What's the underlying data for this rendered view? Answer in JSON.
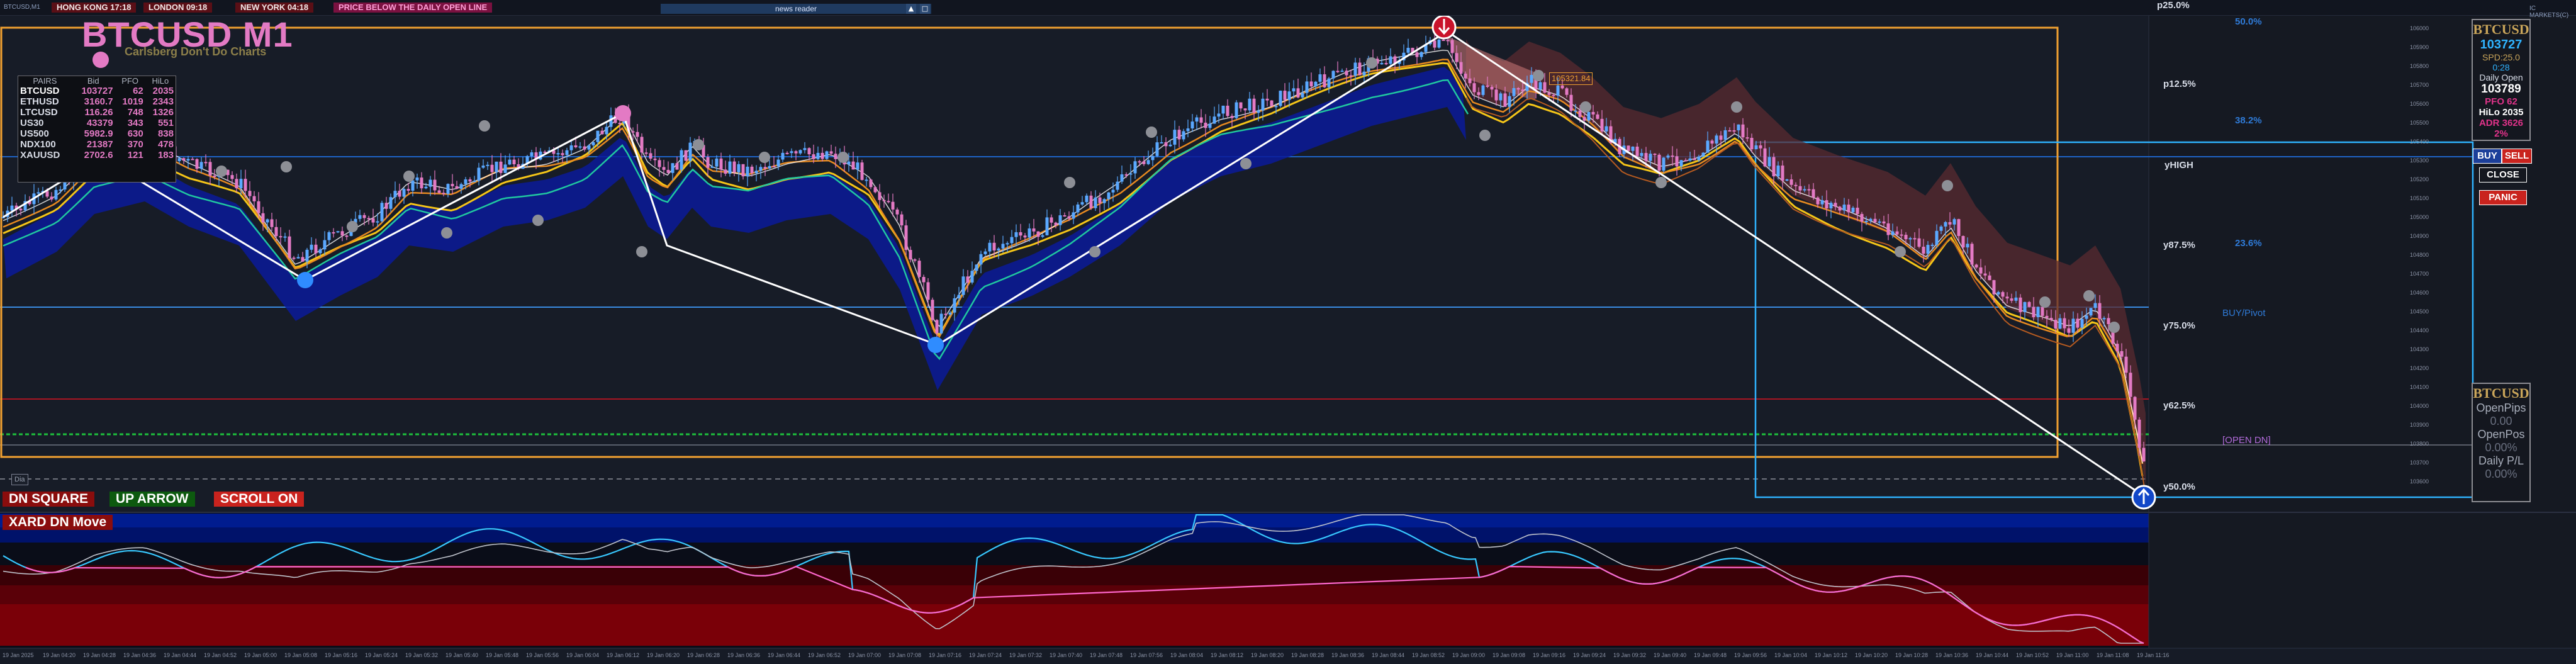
{
  "top_bar": {
    "window_label": "BTCUSD,M1",
    "hongkong": "HONG KONG 17:18",
    "london": "LONDON  09:18",
    "newyork": "NEW YORK  04:18",
    "warning": "PRICE BELOW THE DAILY OPEN LINE",
    "news": "news reader",
    "arrow_btn": "▲",
    "close_btn": "□",
    "right_label": "IC MARKETS(C)"
  },
  "chart_title": "BTCUSD M1",
  "chart_subtitle": "Carlsberg Don't Do Charts",
  "pairs_table": {
    "headers": [
      "PAIRS",
      "Bid",
      "PFO",
      "HiLo"
    ],
    "rows": [
      {
        "name": "BTCUSD",
        "bid": "103727",
        "pfo": "62",
        "hilo": "2035"
      },
      {
        "name": "ETHUSD",
        "bid": "3160.7",
        "pfo": "1019",
        "hilo": "2343"
      },
      {
        "name": "LTCUSD",
        "bid": "116.26",
        "pfo": "748",
        "hilo": "1326"
      },
      {
        "name": "US30",
        "bid": "43379",
        "pfo": "343",
        "hilo": "551"
      },
      {
        "name": "US500",
        "bid": "5982.9",
        "pfo": "630",
        "hilo": "838"
      },
      {
        "name": "NDX100",
        "bid": "21387",
        "pfo": "370",
        "hilo": "478"
      },
      {
        "name": "XAUUSD",
        "bid": "2702.6",
        "pfo": "121",
        "hilo": "183"
      }
    ]
  },
  "status_buttons": {
    "dn_square": "DN SQUARE",
    "up_arrow": "UP ARROW",
    "scroll": "SCROLL ON"
  },
  "indicator_label": "XARD DN Move",
  "small_label": "Dia",
  "box_price": "105321.84",
  "levels": {
    "p25": "p25.0%",
    "p12": "p12.5%",
    "yhigh": "yHIGH",
    "y87": "y87.5%",
    "y75": "y75.0%",
    "y62": "y62.5%",
    "y50": "y50.0%",
    "r50": "50.0%",
    "r38": "38.2%",
    "r23": "23.6%",
    "buy_pivot": "BUY/Pivot",
    "open_dn": "[OPEN DN]"
  },
  "right_panel": {
    "symbol": "BTCUSD",
    "price": "103727",
    "spread": "SPD:25.0",
    "timer": "0:28",
    "daily_open_label": "Daily Open",
    "daily_open": "103789",
    "pfo": "PFO   62",
    "hilo": "HiLo 2035",
    "adr": "ADR 3626",
    "adr_pct": "2%",
    "buy": "BUY",
    "sell": "SELL",
    "close": "CLOSE",
    "panic": "PANIC"
  },
  "position_panel": {
    "symbol": "BTCUSD",
    "open_pips_label": "OpenPips",
    "open_pips": "0.00",
    "open_pos_label": "OpenPos",
    "open_pos": "0.00%",
    "daily_pl_label": "Daily P/L",
    "daily_pl": "0.00%"
  },
  "price_axis": [
    "106000",
    "105900",
    "105800",
    "105700",
    "105600",
    "105500",
    "105400",
    "105300",
    "105200",
    "105100",
    "105000",
    "104900",
    "104800",
    "104700",
    "104600",
    "104500",
    "104400",
    "104300",
    "104200",
    "104100",
    "104000",
    "103900",
    "103800",
    "103700",
    "103600"
  ],
  "time_axis": [
    "19 Jan 2025",
    "19 Jan 04:20",
    "19 Jan 04:28",
    "19 Jan 04:36",
    "19 Jan 04:44",
    "19 Jan 04:52",
    "19 Jan 05:00",
    "19 Jan 05:08",
    "19 Jan 05:16",
    "19 Jan 05:24",
    "19 Jan 05:32",
    "19 Jan 05:40",
    "19 Jan 05:48",
    "19 Jan 05:56",
    "19 Jan 06:04",
    "19 Jan 06:12",
    "19 Jan 06:20",
    "19 Jan 06:28",
    "19 Jan 06:36",
    "19 Jan 06:44",
    "19 Jan 06:52",
    "19 Jan 07:00",
    "19 Jan 07:08",
    "19 Jan 07:16",
    "19 Jan 07:24",
    "19 Jan 07:32",
    "19 Jan 07:40",
    "19 Jan 07:48",
    "19 Jan 07:56",
    "19 Jan 08:04",
    "19 Jan 08:12",
    "19 Jan 08:20",
    "19 Jan 08:28",
    "19 Jan 08:36",
    "19 Jan 08:44",
    "19 Jan 08:52",
    "19 Jan 09:00",
    "19 Jan 09:08",
    "19 Jan 09:16",
    "19 Jan 09:24",
    "19 Jan 09:32",
    "19 Jan 09:40",
    "19 Jan 09:48",
    "19 Jan 09:56",
    "19 Jan 10:04",
    "19 Jan 10:12",
    "19 Jan 10:20",
    "19 Jan 10:28",
    "19 Jan 10:36",
    "19 Jan 10:44",
    "19 Jan 10:52",
    "19 Jan 11:00",
    "19 Jan 11:08",
    "19 Jan 11:16"
  ],
  "colors": {
    "bull_candle": "#5aa8ff",
    "bear_candle": "#e37ac4",
    "accent_orange": "#f0a030",
    "accent_blue": "#2f7bd8",
    "zigzag": "#ffffff"
  }
}
